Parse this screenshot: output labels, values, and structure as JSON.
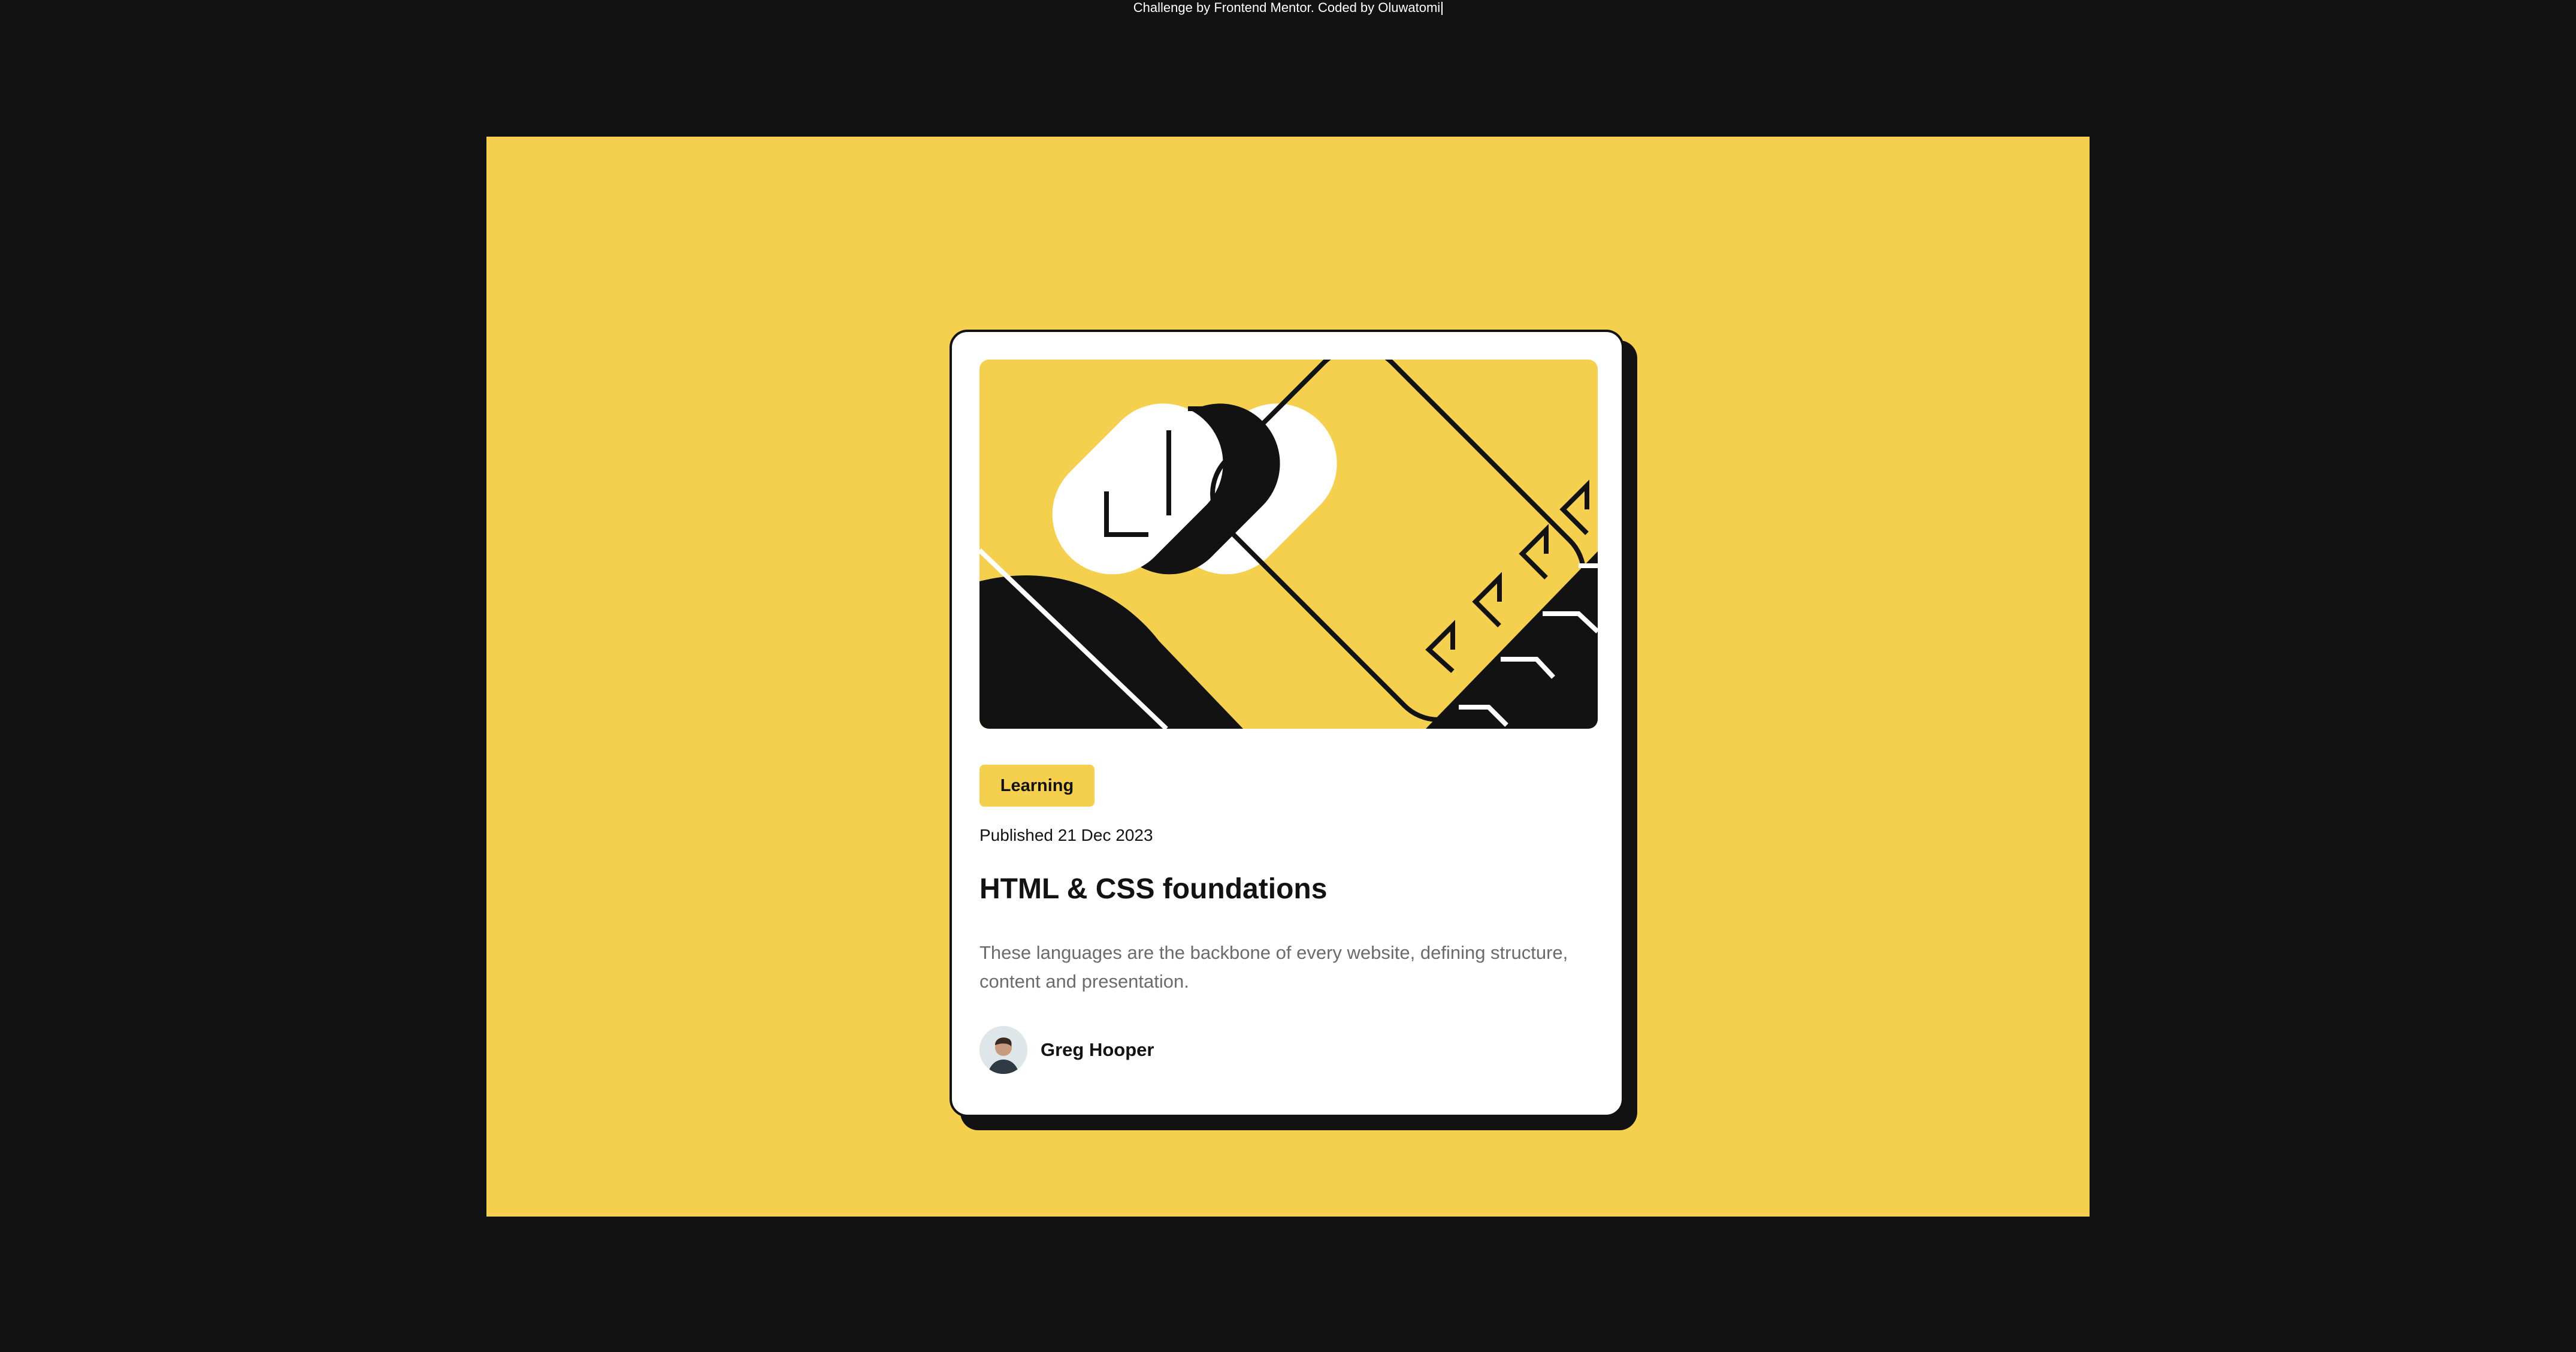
{
  "attribution": {
    "text": "Challenge by Frontend Mentor. Coded by Oluwatomi"
  },
  "colors": {
    "background": "#121212",
    "accent_yellow": "#f4d04e",
    "card": "#ffffff",
    "body_text": "#6b6b6b"
  },
  "card": {
    "illustration_icon": "abstract-illustration",
    "tag": "Learning",
    "published": "Published 21 Dec 2023",
    "title": "HTML & CSS foundations",
    "description": "These languages are the backbone of every website, defining structure, content and presentation.",
    "author": {
      "avatar_icon": "person-avatar",
      "name": "Greg Hooper"
    }
  }
}
